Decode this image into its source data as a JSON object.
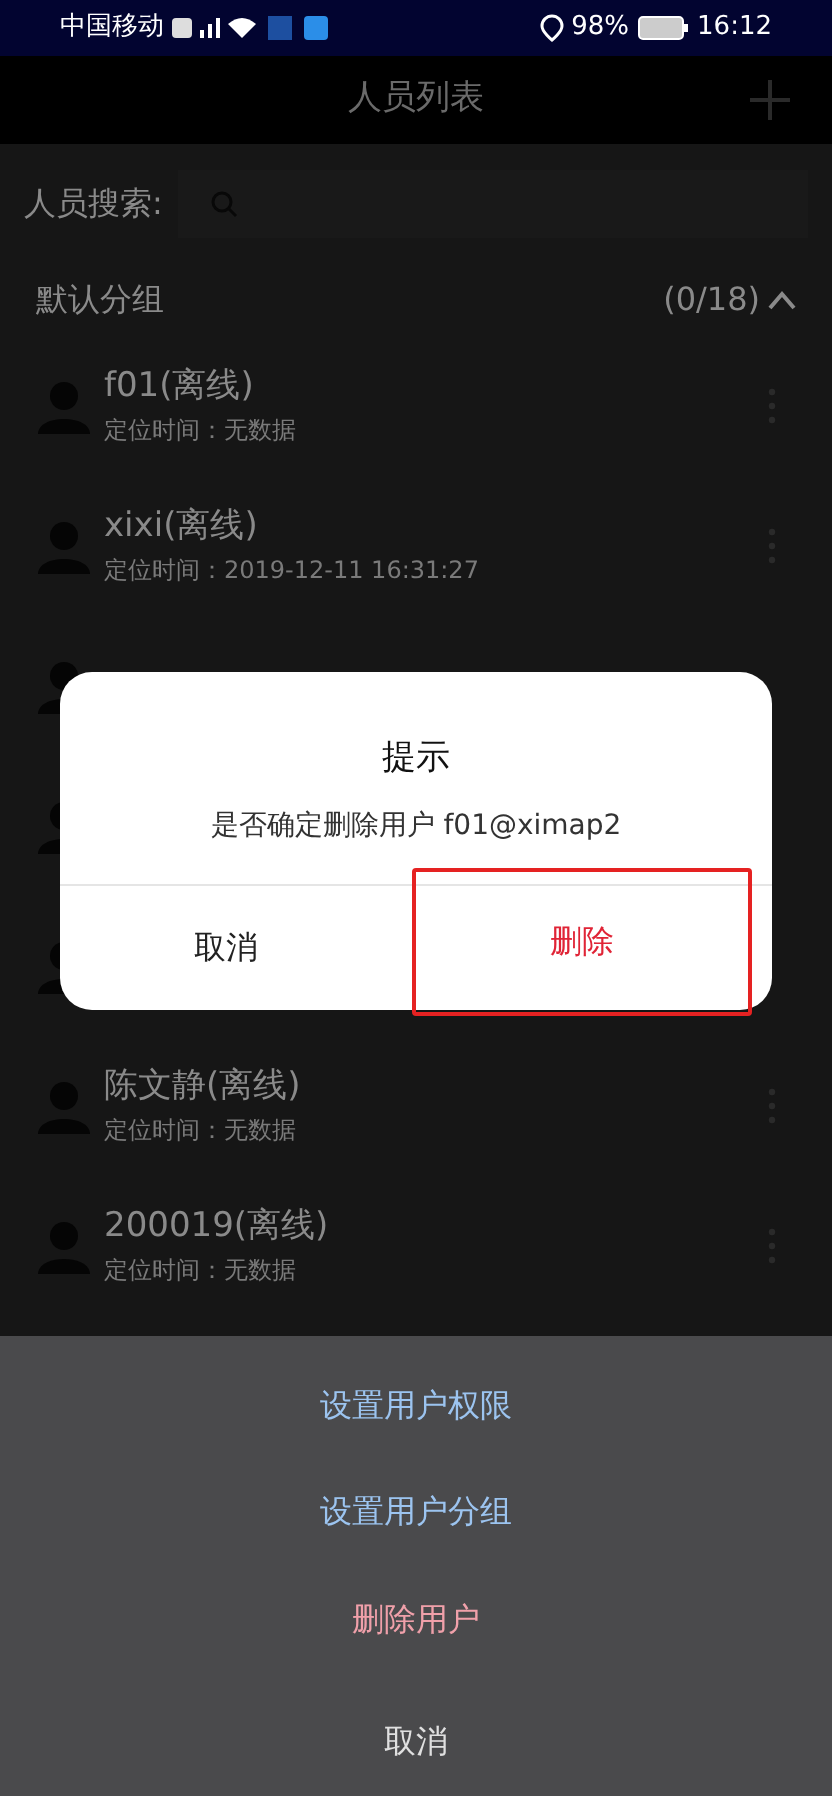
{
  "status_bar": {
    "carrier": "中国移动",
    "battery": "98%",
    "time": "16:12"
  },
  "header": {
    "title": "人员列表"
  },
  "search": {
    "label": "人员搜索:"
  },
  "group": {
    "name": "默认分组",
    "count": "(0/18)",
    "expanded": true
  },
  "people": [
    {
      "name": "f01(离线)",
      "detail": "定位时间：无数据"
    },
    {
      "name": "xixi(离线)",
      "detail": "定位时间：2019-12-11 16:31:27"
    },
    {
      "kind": "covered"
    },
    {
      "kind": "covered"
    },
    {
      "kind": "covered"
    },
    {
      "name": "陈文静(离线)",
      "detail": "定位时间：无数据"
    },
    {
      "name": "200019(离线)",
      "detail": "定位时间：无数据"
    }
  ],
  "dialog": {
    "title": "提示",
    "message": "是否确定删除用户 f01@ximap2",
    "buttons": [
      {
        "label": "取消",
        "kind": "cancel",
        "highlighted": false
      },
      {
        "label": "删除",
        "kind": "danger",
        "highlighted": true
      }
    ]
  },
  "action_sheet": [
    {
      "label": "设置用户权限",
      "kind": "normal"
    },
    {
      "label": "设置用户分组",
      "kind": "normal"
    },
    {
      "label": "删除用户",
      "kind": "danger"
    },
    {
      "label": "取消",
      "kind": "cancel"
    }
  ]
}
